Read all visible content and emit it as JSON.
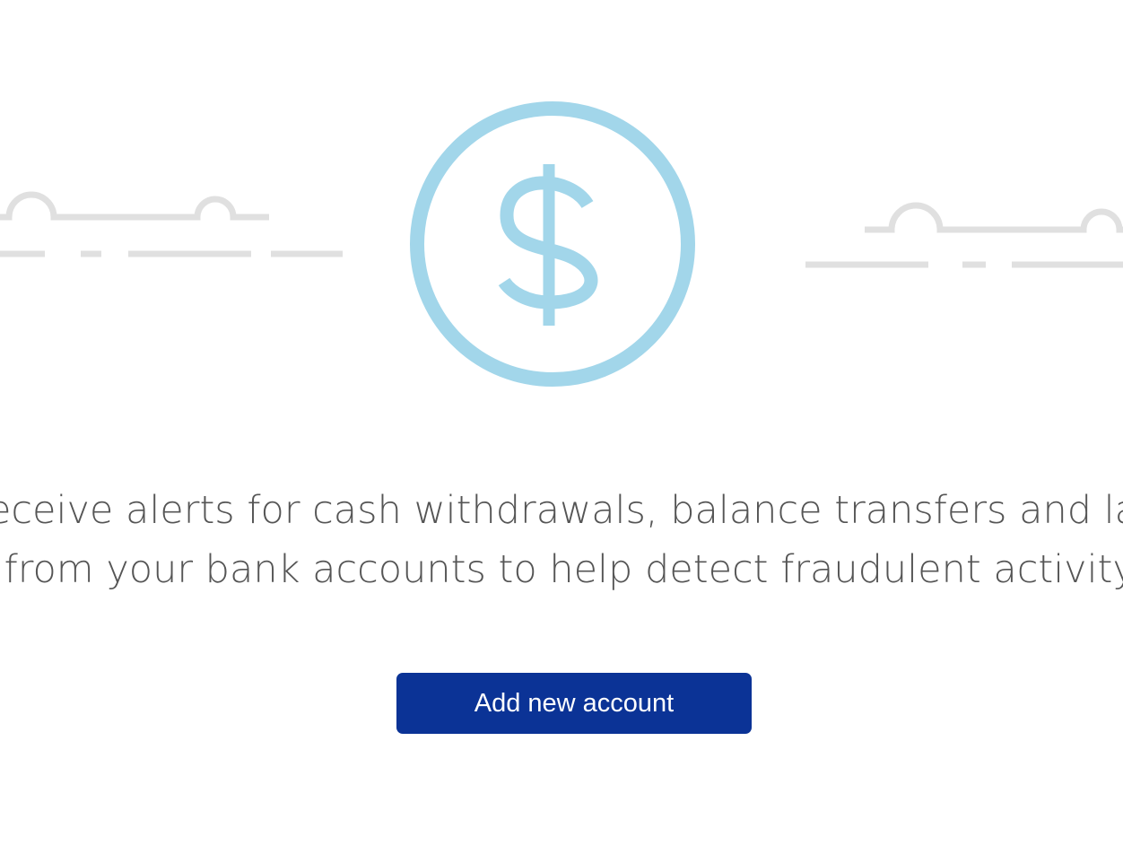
{
  "description": {
    "line_1": "Receive alerts for cash withdrawals, balance transfers and large purchases",
    "line_2": "from your bank accounts to help detect fraudulent activity."
  },
  "add_account_button": {
    "label": "Add new account"
  },
  "icons": {
    "main": "dollar-circle-icon",
    "decorative": "cloud-line-icon"
  },
  "colors": {
    "icon_accent": "#a2d6ea",
    "cloud_lines": "#e0e0e0",
    "button_background": "#0b3396",
    "button_text": "#ffffff",
    "body_text": "#555555"
  }
}
